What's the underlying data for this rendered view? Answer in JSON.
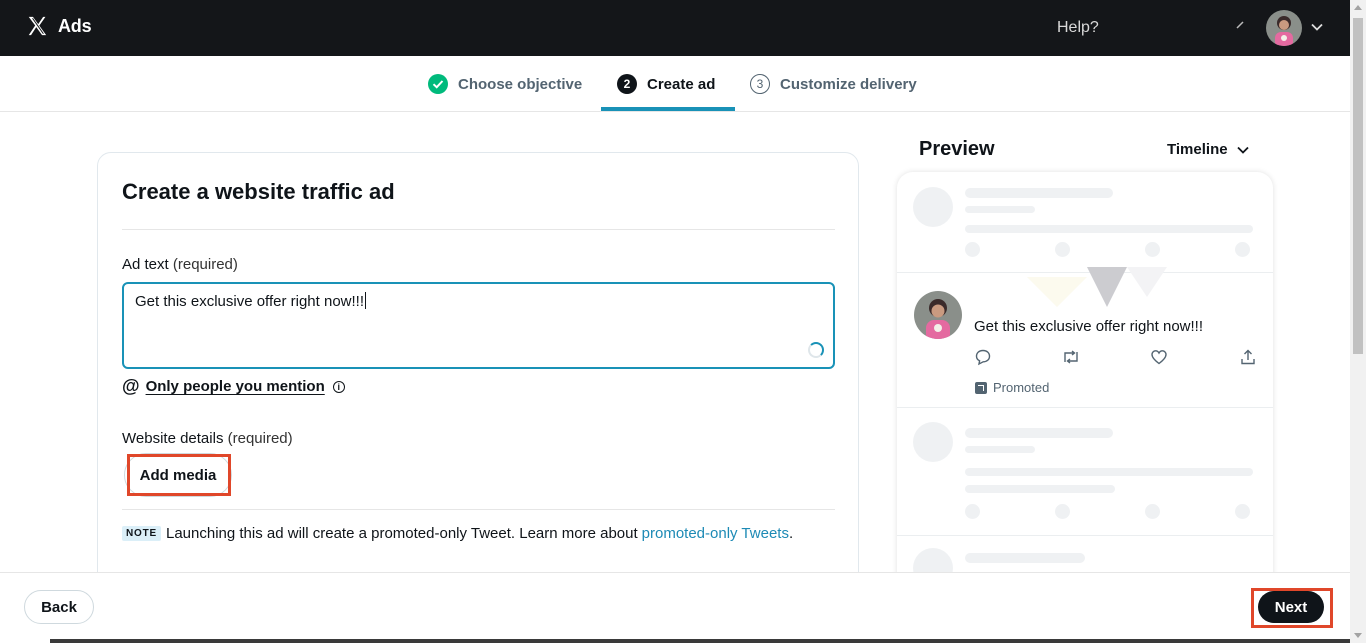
{
  "header": {
    "brand": "Ads",
    "help_label": "Help?"
  },
  "stepper": {
    "steps": [
      {
        "label": "Choose objective",
        "state": "done"
      },
      {
        "label": "Create ad",
        "number": "2",
        "state": "active"
      },
      {
        "label": "Customize delivery",
        "number": "3",
        "state": "todo"
      }
    ]
  },
  "form": {
    "title": "Create a website traffic ad",
    "ad_text_label": "Ad text",
    "ad_text_required": "(required)",
    "ad_text_value": "Get this exclusive offer right now!!!",
    "mention_link": "Only people you mention",
    "website_label": "Website details",
    "website_required": "(required)",
    "add_media_label": "Add media",
    "note_badge": "NOTE",
    "note_text": "Launching this ad will create a promoted-only Tweet. Learn more about",
    "note_link": "promoted-only Tweets",
    "note_end": "."
  },
  "preview": {
    "title": "Preview",
    "placement": "Timeline",
    "tweet_text": "Get this exclusive offer right now!!!",
    "promoted_label": "Promoted"
  },
  "footer": {
    "back_label": "Back",
    "next_label": "Next"
  },
  "colors": {
    "accent": "#1992b7",
    "highlight": "#e0472a",
    "header_bg": "#141619",
    "done_green": "#00ba7c"
  }
}
